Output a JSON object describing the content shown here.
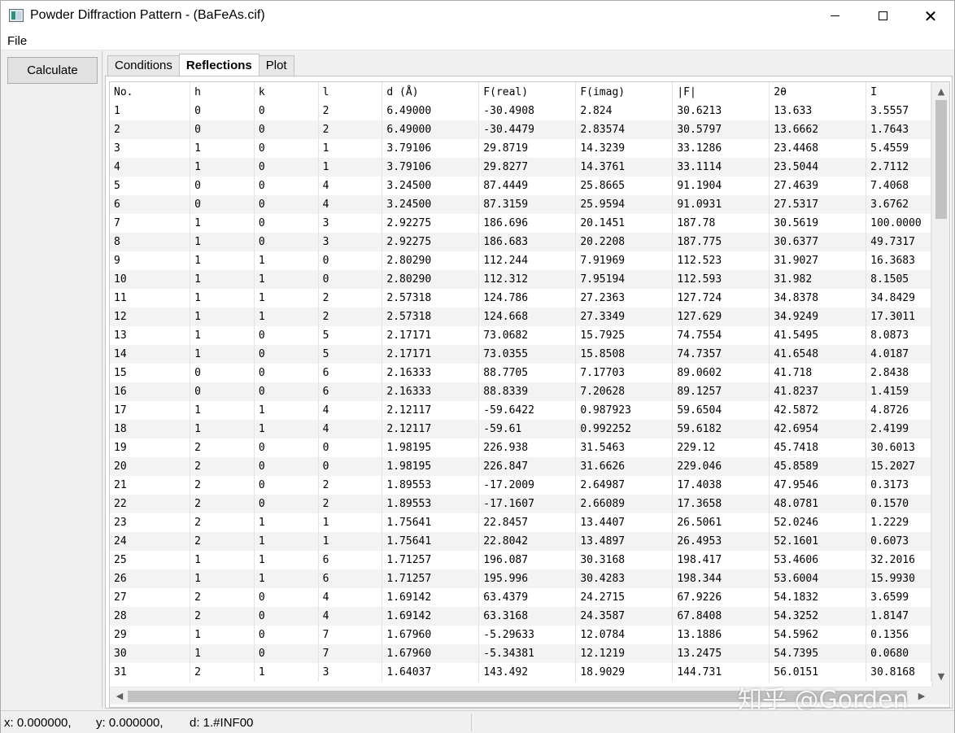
{
  "window": {
    "title": "Powder Diffraction Pattern - (BaFeAs.cif)",
    "icon": "app-window-icon"
  },
  "menu": {
    "file_label": "File"
  },
  "toolbar": {
    "calculate_label": "Calculate"
  },
  "tabs": [
    {
      "label": "Conditions",
      "active": false
    },
    {
      "label": "Reflections",
      "active": true
    },
    {
      "label": "Plot",
      "active": false
    }
  ],
  "reflections": {
    "columns": [
      "No.",
      "h",
      "k",
      "l",
      "d (Å)",
      "F(real)",
      "F(imag)",
      "|F|",
      "2θ",
      "I"
    ],
    "rows": [
      [
        "1",
        "0",
        "0",
        "2",
        "6.49000",
        "-30.4908",
        "2.824",
        "30.6213",
        "13.633",
        "3.5557"
      ],
      [
        "2",
        "0",
        "0",
        "2",
        "6.49000",
        "-30.4479",
        "2.83574",
        "30.5797",
        "13.6662",
        "1.7643"
      ],
      [
        "3",
        "1",
        "0",
        "1",
        "3.79106",
        "29.8719",
        "14.3239",
        "33.1286",
        "23.4468",
        "5.4559"
      ],
      [
        "4",
        "1",
        "0",
        "1",
        "3.79106",
        "29.8277",
        "14.3761",
        "33.1114",
        "23.5044",
        "2.7112"
      ],
      [
        "5",
        "0",
        "0",
        "4",
        "3.24500",
        "87.4449",
        "25.8665",
        "91.1904",
        "27.4639",
        "7.4068"
      ],
      [
        "6",
        "0",
        "0",
        "4",
        "3.24500",
        "87.3159",
        "25.9594",
        "91.0931",
        "27.5317",
        "3.6762"
      ],
      [
        "7",
        "1",
        "0",
        "3",
        "2.92275",
        "186.696",
        "20.1451",
        "187.78",
        "30.5619",
        "100.0000"
      ],
      [
        "8",
        "1",
        "0",
        "3",
        "2.92275",
        "186.683",
        "20.2208",
        "187.775",
        "30.6377",
        "49.7317"
      ],
      [
        "9",
        "1",
        "1",
        "0",
        "2.80290",
        "112.244",
        "7.91969",
        "112.523",
        "31.9027",
        "16.3683"
      ],
      [
        "10",
        "1",
        "1",
        "0",
        "2.80290",
        "112.312",
        "7.95194",
        "112.593",
        "31.982",
        "8.1505"
      ],
      [
        "11",
        "1",
        "1",
        "2",
        "2.57318",
        "124.786",
        "27.2363",
        "127.724",
        "34.8378",
        "34.8429"
      ],
      [
        "12",
        "1",
        "1",
        "2",
        "2.57318",
        "124.668",
        "27.3349",
        "127.629",
        "34.9249",
        "17.3011"
      ],
      [
        "13",
        "1",
        "0",
        "5",
        "2.17171",
        "73.0682",
        "15.7925",
        "74.7554",
        "41.5495",
        "8.0873"
      ],
      [
        "14",
        "1",
        "0",
        "5",
        "2.17171",
        "73.0355",
        "15.8508",
        "74.7357",
        "41.6548",
        "4.0187"
      ],
      [
        "15",
        "0",
        "0",
        "6",
        "2.16333",
        "88.7705",
        "7.17703",
        "89.0602",
        "41.718",
        "2.8438"
      ],
      [
        "16",
        "0",
        "0",
        "6",
        "2.16333",
        "88.8339",
        "7.20628",
        "89.1257",
        "41.8237",
        "1.4159"
      ],
      [
        "17",
        "1",
        "1",
        "4",
        "2.12117",
        "-59.6422",
        "0.987923",
        "59.6504",
        "42.5872",
        "4.8726"
      ],
      [
        "18",
        "1",
        "1",
        "4",
        "2.12117",
        "-59.61",
        "0.992252",
        "59.6182",
        "42.6954",
        "2.4199"
      ],
      [
        "19",
        "2",
        "0",
        "0",
        "1.98195",
        "226.938",
        "31.5463",
        "229.12",
        "45.7418",
        "30.6013"
      ],
      [
        "20",
        "2",
        "0",
        "0",
        "1.98195",
        "226.847",
        "31.6626",
        "229.046",
        "45.8589",
        "15.2027"
      ],
      [
        "21",
        "2",
        "0",
        "2",
        "1.89553",
        "-17.2009",
        "2.64987",
        "17.4038",
        "47.9546",
        "0.3173"
      ],
      [
        "22",
        "2",
        "0",
        "2",
        "1.89553",
        "-17.1607",
        "2.66089",
        "17.3658",
        "48.0781",
        "0.1570"
      ],
      [
        "23",
        "2",
        "1",
        "1",
        "1.75641",
        "22.8457",
        "13.4407",
        "26.5061",
        "52.0246",
        "1.2229"
      ],
      [
        "24",
        "2",
        "1",
        "1",
        "1.75641",
        "22.8042",
        "13.4897",
        "26.4953",
        "52.1601",
        "0.6073"
      ],
      [
        "25",
        "1",
        "1",
        "6",
        "1.71257",
        "196.087",
        "30.3168",
        "198.417",
        "53.4606",
        "32.2016"
      ],
      [
        "26",
        "1",
        "1",
        "6",
        "1.71257",
        "195.996",
        "30.4283",
        "198.344",
        "53.6004",
        "15.9930"
      ],
      [
        "27",
        "2",
        "0",
        "4",
        "1.69142",
        "63.4379",
        "24.2715",
        "67.9226",
        "54.1832",
        "3.6599"
      ],
      [
        "28",
        "2",
        "0",
        "4",
        "1.69142",
        "63.3168",
        "24.3587",
        "67.8408",
        "54.3252",
        "1.8147"
      ],
      [
        "29",
        "1",
        "0",
        "7",
        "1.67960",
        "-5.29633",
        "12.0784",
        "13.1886",
        "54.5962",
        "0.1356"
      ],
      [
        "30",
        "1",
        "0",
        "7",
        "1.67960",
        "-5.34381",
        "12.1219",
        "13.2475",
        "54.7395",
        "0.0680"
      ],
      [
        "31",
        "2",
        "1",
        "3",
        "1.64037",
        "143.492",
        "18.9029",
        "144.731",
        "56.0151",
        "30.8168"
      ]
    ]
  },
  "scrollbar": {
    "up_icon": "arrow-up-icon",
    "down_icon": "arrow-down-icon",
    "left_icon": "arrow-left-icon",
    "right_icon": "arrow-right-icon"
  },
  "watermark": "知乎 @Gorden",
  "status": {
    "x": "x: 0.000000,",
    "y": "y: 0.000000,",
    "d": "d: 1.#INF00"
  },
  "colors": {
    "window_bg": "#f0f0f0",
    "table_bg": "#ffffff",
    "alt_row": "#f3f3f3",
    "scroll_thumb": "#c1c1c1"
  }
}
